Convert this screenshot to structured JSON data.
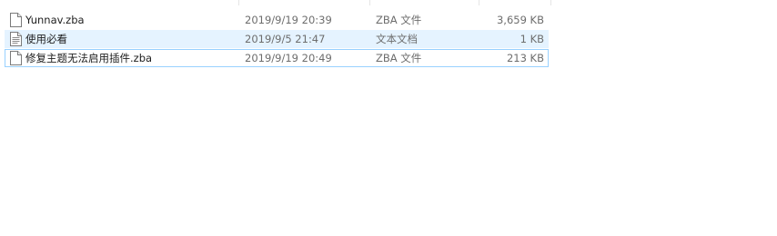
{
  "files": [
    {
      "name": "Yunnav.zba",
      "date": "2019/9/19 20:39",
      "type": "ZBA 文件",
      "size": "3,659 KB",
      "icon": "blank-file-icon"
    },
    {
      "name": "使用必看",
      "date": "2019/9/5 21:47",
      "type": "文本文档",
      "size": "1 KB",
      "icon": "text-file-icon"
    },
    {
      "name": "修复主题无法启用插件.zba",
      "date": "2019/9/19 20:49",
      "type": "ZBA 文件",
      "size": "213 KB",
      "icon": "blank-file-icon"
    }
  ]
}
